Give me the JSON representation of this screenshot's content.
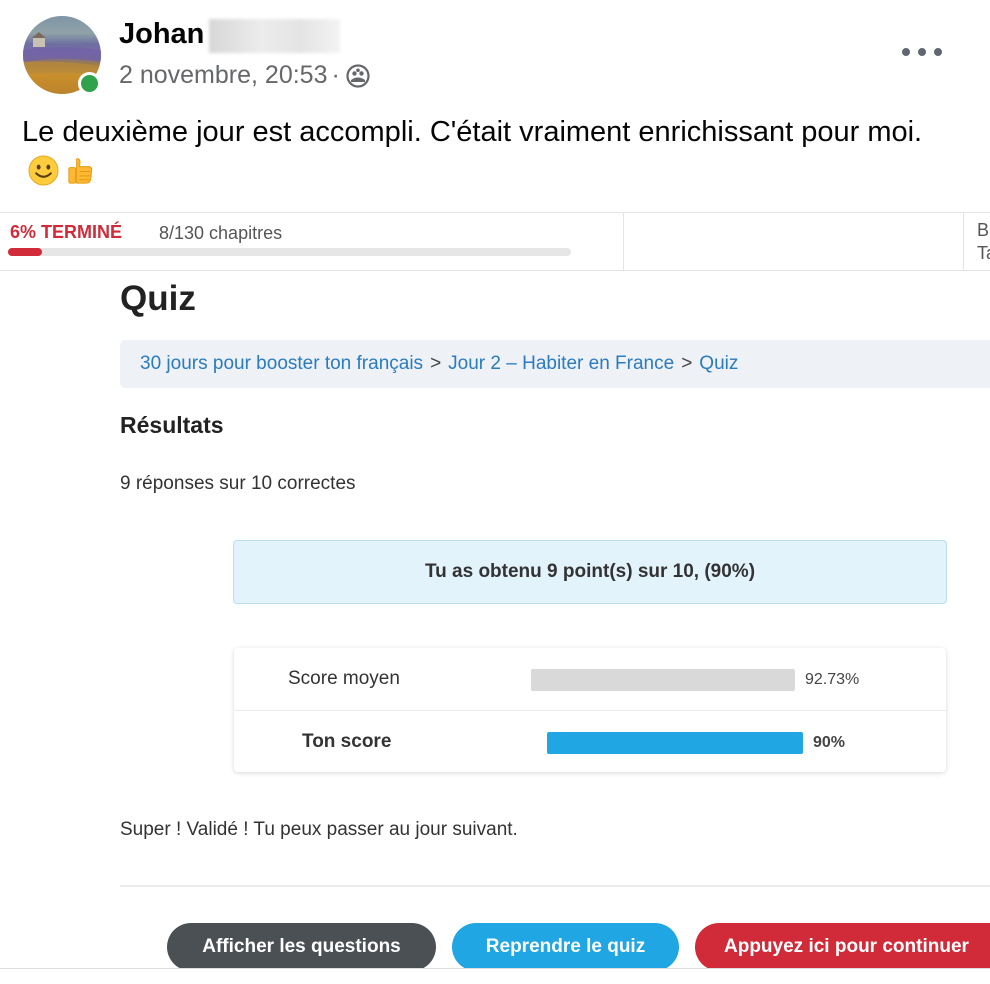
{
  "post": {
    "author": "Johan",
    "date": "2 novembre, 20:53",
    "meta_separator": "·",
    "audience_icon": "friends-icon",
    "text": "Le deuxième jour est accompli. C'était vraiment enrichissant pour moi.",
    "emojis": [
      "slightly-smiling-face",
      "thumbs-up"
    ],
    "online_status_color": "#31a24c"
  },
  "course": {
    "progress_label": "6% TERMINÉ",
    "progress_fraction": 0.06,
    "chapters": "8/130 chapitres",
    "cut_text_1": "B",
    "cut_text_2": "Ta",
    "accent": "#d12a38"
  },
  "quiz": {
    "title": "Quiz",
    "breadcrumb": {
      "course": "30 jours pour booster ton français",
      "separator": ">",
      "lesson": "Jour 2 – Habiter en France",
      "current": "Quiz"
    },
    "results_heading": "Résultats",
    "results_summary": "9 réponses sur 10 correctes",
    "score_message": "Tu as obtenu 9 point(s) sur 10, (90%)",
    "comparison": {
      "average": {
        "label": "Score moyen",
        "value_text": "92.73%",
        "value": 92.73,
        "color": "#d9d9d9"
      },
      "yours": {
        "label": "Ton score",
        "value_text": "90%",
        "value": 90,
        "color": "#1fa6e3"
      }
    },
    "result_text": "Super ! Validé ! Tu peux passer au jour suivant.",
    "buttons": {
      "show_questions": "Afficher les questions",
      "retry": "Reprendre le quiz",
      "continue": "Appuyez ici pour continuer"
    }
  }
}
